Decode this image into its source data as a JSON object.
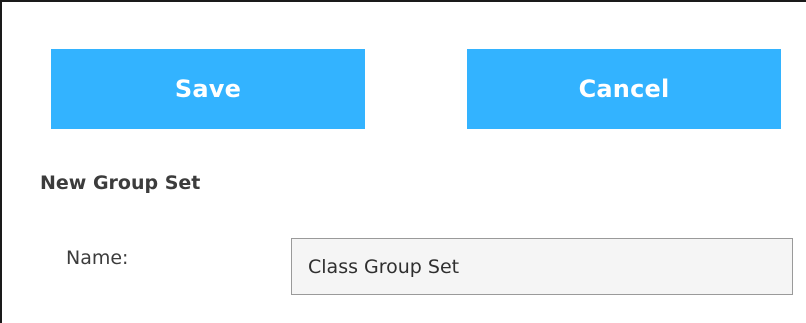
{
  "actions": {
    "save_label": "Save",
    "cancel_label": "Cancel"
  },
  "form": {
    "section_title": "New Group Set",
    "name_label": "Name:",
    "name_value": "Class Group Set"
  },
  "colors": {
    "button_background": "#33b3ff",
    "button_text": "#ffffff",
    "label_text": "#3c3c3c",
    "input_background": "#f5f5f5",
    "input_border": "#9a9a9a"
  }
}
